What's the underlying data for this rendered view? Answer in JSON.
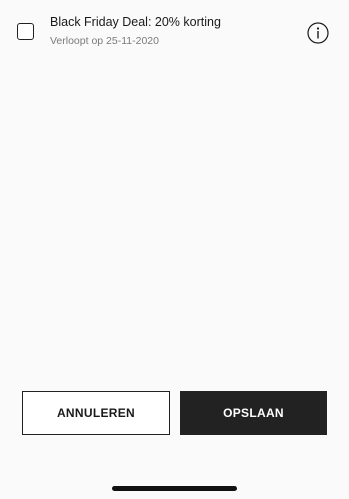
{
  "deal": {
    "title": "Black Friday Deal: 20% korting",
    "expiry": "Verloopt op 25-11-2020",
    "checked": false,
    "info_icon": "info-circle-icon"
  },
  "actions": {
    "cancel_label": "ANNULEREN",
    "save_label": "OPSLAAN"
  }
}
